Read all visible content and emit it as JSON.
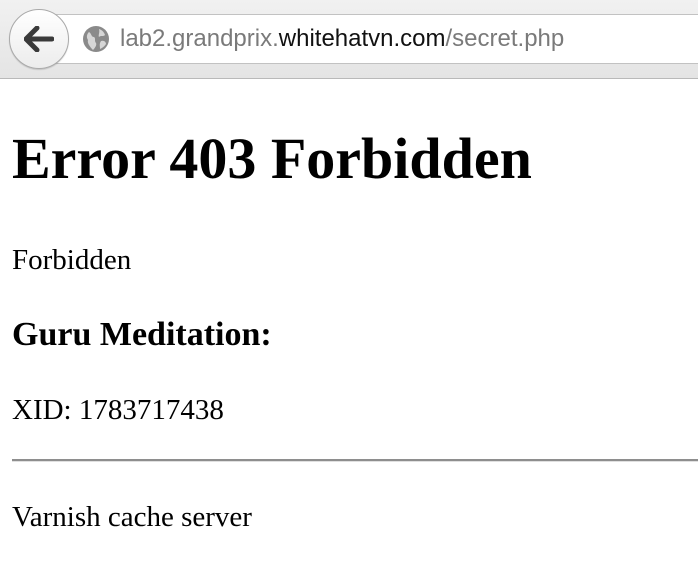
{
  "browser": {
    "url_prefix": "lab2.grandprix.",
    "url_domain": "whitehatvn.com",
    "url_path": "/secret.php",
    "back_icon": "back-arrow-icon",
    "site_icon": "globe-icon"
  },
  "page": {
    "heading": "Error 403 Forbidden",
    "message": "Forbidden",
    "subheading": "Guru Meditation:",
    "xid": "XID: 1783717438",
    "footer": "Varnish cache server"
  }
}
